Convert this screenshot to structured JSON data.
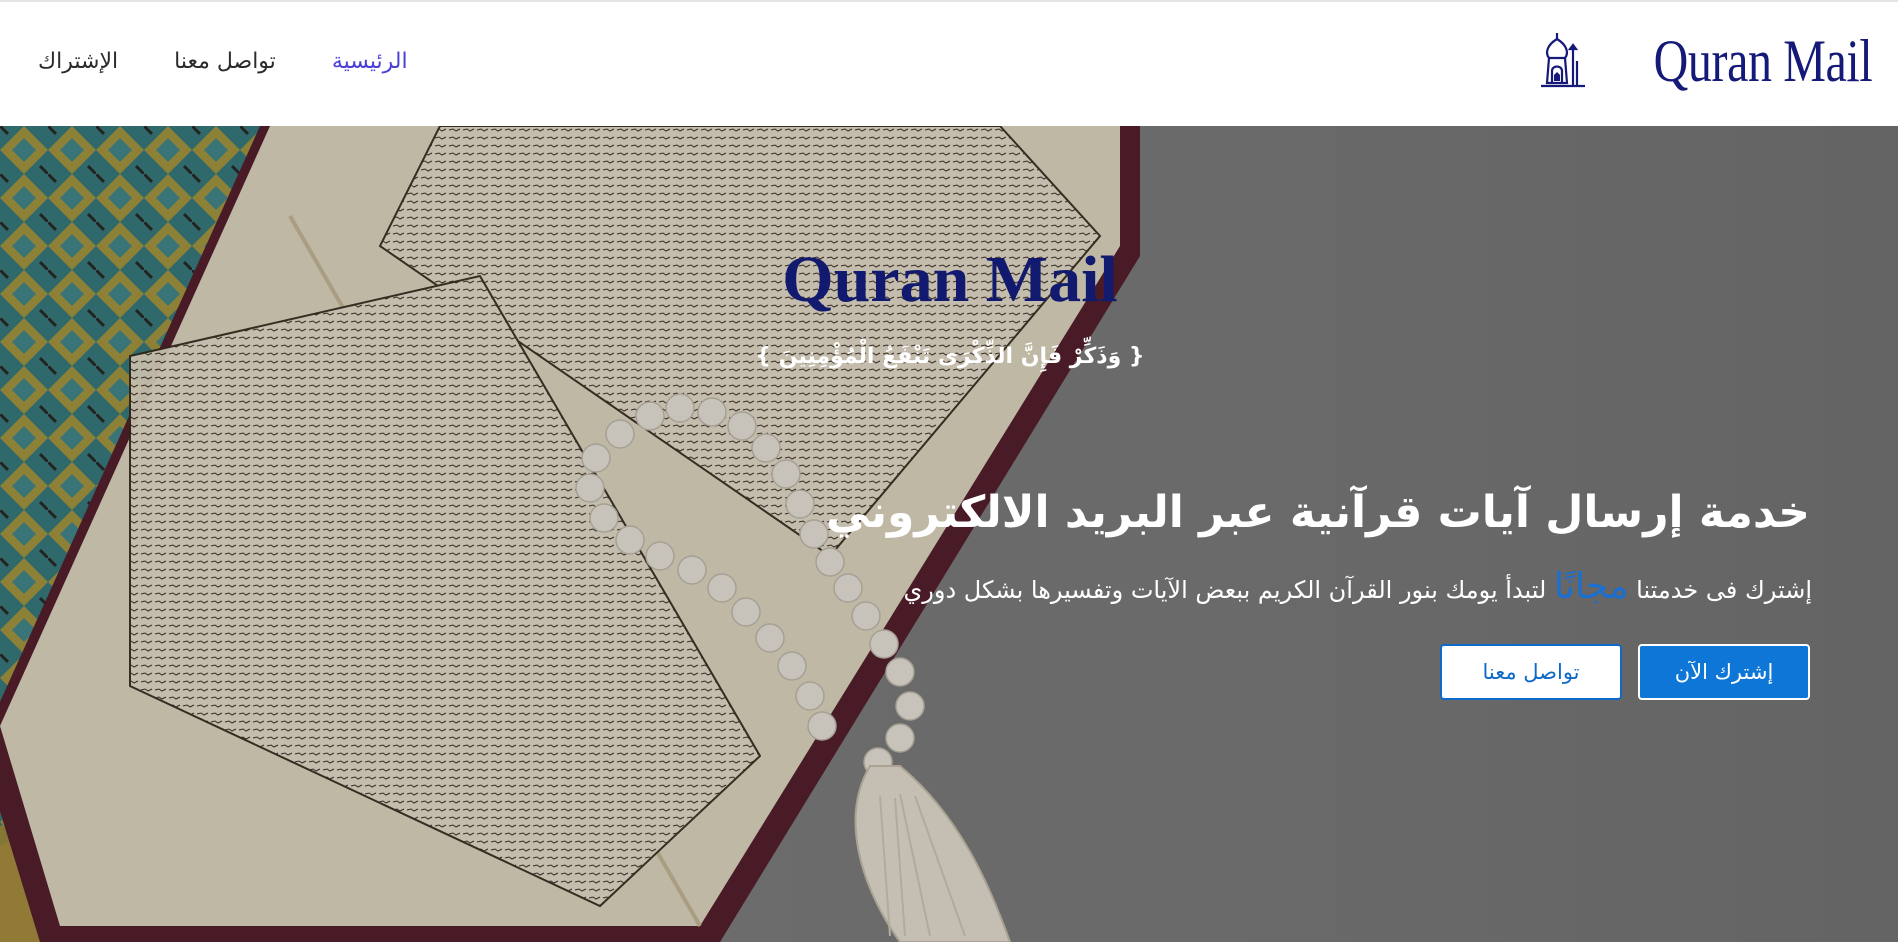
{
  "nav": {
    "brand": "Quran Mail",
    "links": [
      {
        "label": "الرئيسية",
        "active": true
      },
      {
        "label": "تواصل معنا",
        "active": false
      },
      {
        "label": "الإشتراك",
        "active": false
      }
    ]
  },
  "hero": {
    "title": "Quran Mail",
    "ayah": "{ وَذَكِّرْ فَإِنَّ الذِّكْرَى تَنْفَعُ الْمُؤْمِنِينَ }",
    "headline": "خدمة إرسال آيات قرآنية عبر البريد الالكتروني",
    "subtitle_before": "إشترك فى خدمتنا",
    "subtitle_highlight": "مجانًا",
    "subtitle_after": "لتبدأ يومك بنور القرآن الكريم ببعض الآيات وتفسيرها بشكل دوري",
    "primary_button": "إشترك الآن",
    "secondary_button": "تواصل معنا"
  },
  "colors": {
    "brand_navy": "#151a78",
    "active_link": "#4a3fd6",
    "primary_blue": "#0d76d6",
    "highlight_blue": "#1a6fd0"
  },
  "icons": [
    "mosque-lantern-icon"
  ],
  "images": [
    "quran-and-prayer-beads-background"
  ]
}
